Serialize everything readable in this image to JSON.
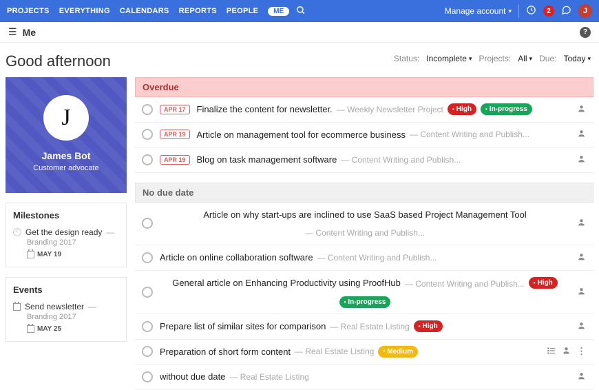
{
  "nav": {
    "projects": "PROJECTS",
    "everything": "EVERYTHING",
    "calendars": "CALENDARS",
    "reports": "REPORTS",
    "people": "PEOPLE",
    "me": "ME"
  },
  "topright": {
    "manage": "Manage account",
    "notif_count": "2",
    "avatar_letter": "J"
  },
  "subhead": {
    "title": "Me"
  },
  "greeting": "Good afternoon",
  "filters": {
    "status_label": "Status:",
    "status_value": "Incomplete",
    "projects_label": "Projects:",
    "projects_value": "All",
    "due_label": "Due:",
    "due_value": "Today"
  },
  "profile": {
    "avatar_letter": "J",
    "name": "James Bot",
    "role": "Customer advocate"
  },
  "milestones": {
    "heading": "Milestones",
    "item": {
      "title": "Get the design ready",
      "dash": "—",
      "project": "Branding 2017",
      "date": "MAY 19"
    }
  },
  "events": {
    "heading": "Events",
    "item": {
      "title": "Send newsletter",
      "dash": "—",
      "project": "Branding 2017",
      "date": "MAY 25"
    }
  },
  "groups": {
    "overdue": "Overdue",
    "nodue": "No due date"
  },
  "tasks_overdue": [
    {
      "date": "APR 17",
      "title": "Finalize the content for newsletter.",
      "proj": "— Weekly Newsletter Project",
      "high": "High",
      "inprog": "In-progress"
    },
    {
      "date": "APR 19",
      "title": "Article on management tool for ecommerce business",
      "proj": "— Content Writing and Publish..."
    },
    {
      "date": "APR 19",
      "title": "Blog on task management software",
      "proj": "— Content Writing and Publish..."
    }
  ],
  "tasks_nodue": [
    {
      "title": "Article on why start-ups are inclined to use SaaS based Project Management Tool",
      "proj": "— Content Writing and Publish...",
      "stack": true
    },
    {
      "title": "Article on online collaboration software",
      "proj": "— Content Writing and Publish..."
    },
    {
      "title": "General article on Enhancing Productivity using ProofHub",
      "proj": "— Content Writing and Publish...",
      "high": "High",
      "inprog_below": "In-progress"
    },
    {
      "title": "Prepare list of similar sites for comparison",
      "proj": "— Real Estate Listing",
      "high": "High"
    },
    {
      "title": "Preparation of short form content",
      "proj": "— Real Estate Listing",
      "medium": "Medium",
      "actions": true
    },
    {
      "title": "without due date",
      "proj": "— Real Estate Listing"
    }
  ]
}
